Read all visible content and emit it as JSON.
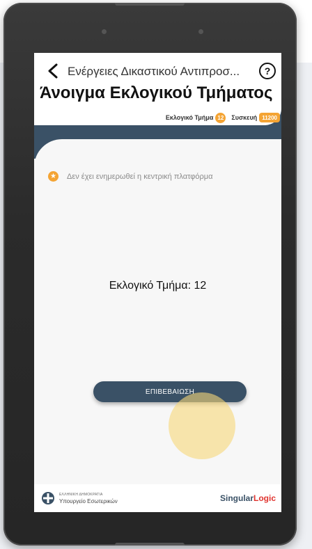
{
  "header": {
    "nav_title": "Ενέργειες Δικαστικού Αντιπροσ...",
    "page_title": "Άνοιγμα Εκλογικού Τμήματος"
  },
  "meta": {
    "section_label": "Εκλογικό Τμήμα",
    "section_value": "12",
    "device_label": "Συσκευή",
    "device_value": "11200"
  },
  "notice": {
    "text": "Δεν έχει ενημερωθεί η κεντρική πλατφόρμα"
  },
  "main": {
    "section_text": "Εκλογικό Τμήμα: 12",
    "confirm_label": "ΕΠΙΒΕΒΑΙΩΣΗ"
  },
  "footer": {
    "ministry_line1": "ΕΛΛΗΝΙΚΗ ΔΗΜΟΚΡΑΤΙΑ",
    "ministry_line2": "Υπουργείο Εσωτερικών",
    "brand_part1": "Singular",
    "brand_part2": "Logic"
  },
  "colors": {
    "primary": "#3a5166",
    "accent": "#f4a434",
    "brand_red": "#e0342f"
  },
  "icons": {
    "back": "chevron-left-icon",
    "help": "question-circle-icon",
    "notice": "star-circle-icon",
    "ministry": "emblem-icon"
  }
}
